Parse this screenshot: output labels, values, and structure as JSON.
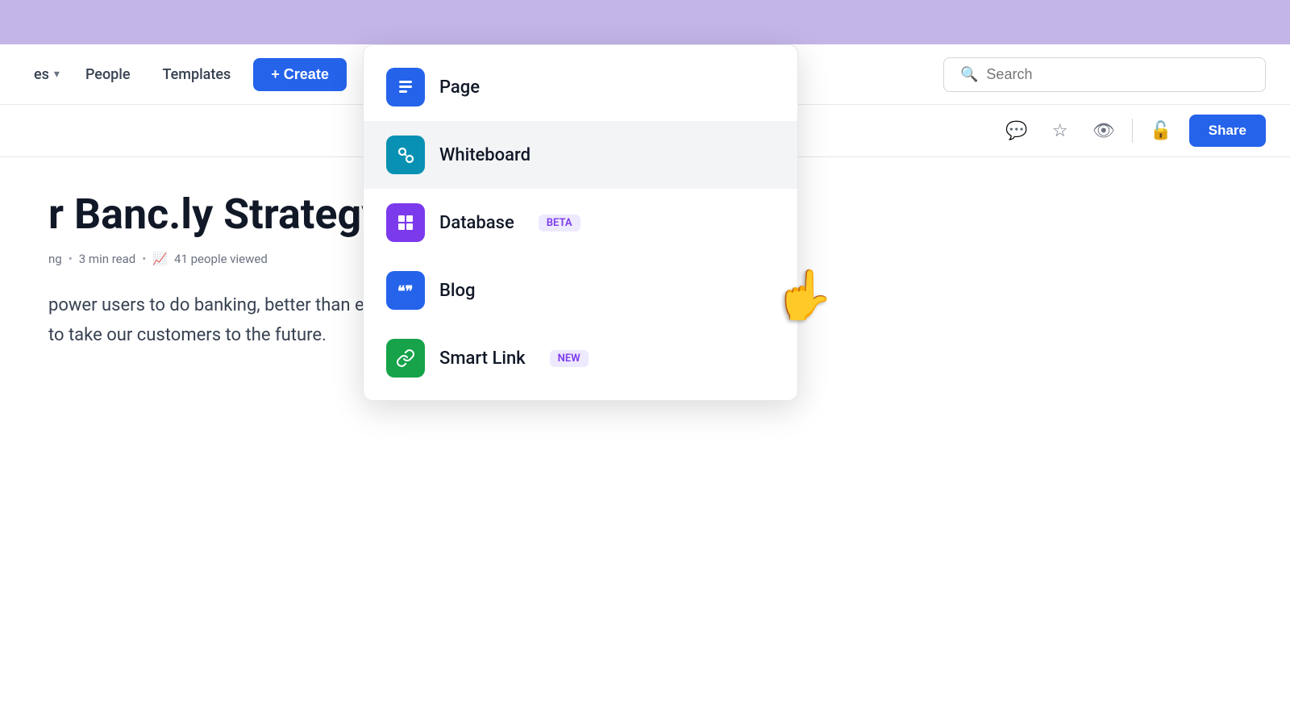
{
  "topBanner": {},
  "navbar": {
    "spacesLabel": "es",
    "peopleLabel": "People",
    "templatesLabel": "Templates",
    "createLabel": "+ Create",
    "search": {
      "placeholder": "Search"
    }
  },
  "toolbar": {
    "shareLabel": "Share",
    "icons": [
      {
        "name": "comment-icon",
        "symbol": "💬"
      },
      {
        "name": "star-icon",
        "symbol": "☆"
      },
      {
        "name": "eye-icon",
        "symbol": "👁"
      },
      {
        "name": "lock-icon",
        "symbol": "🔓"
      }
    ]
  },
  "page": {
    "title": "r Banc.ly Strategy",
    "metaAuthor": "ng",
    "metaReadTime": "3 min read",
    "metaViews": "41 people viewed",
    "bodyText1": "power users to do banking, better than ever. We are a credit card company",
    "bodyText2": "to take our customers to the future."
  },
  "dropdown": {
    "items": [
      {
        "id": "page",
        "label": "Page",
        "iconClass": "icon-page",
        "iconSymbol": "☰",
        "badge": null
      },
      {
        "id": "whiteboard",
        "label": "Whiteboard",
        "iconClass": "icon-whiteboard",
        "iconSymbol": "✦",
        "badge": null,
        "highlighted": true
      },
      {
        "id": "database",
        "label": "Database",
        "iconClass": "icon-database",
        "iconSymbol": "⊞",
        "badge": "BETA",
        "badgeClass": "badge-beta"
      },
      {
        "id": "blog",
        "label": "Blog",
        "iconClass": "icon-blog",
        "iconSymbol": "❝❞",
        "badge": null
      },
      {
        "id": "smartlink",
        "label": "Smart Link",
        "iconClass": "icon-smartlink",
        "iconSymbol": "🔗",
        "badge": "NEW",
        "badgeClass": "badge-new"
      }
    ]
  }
}
